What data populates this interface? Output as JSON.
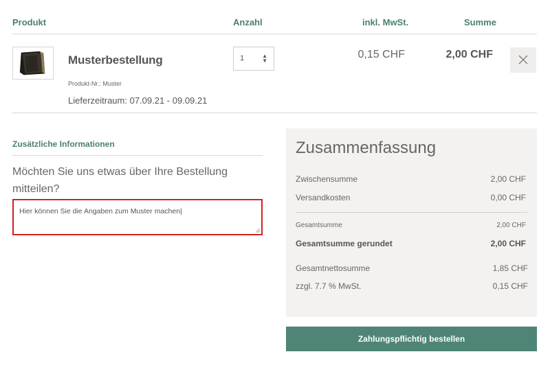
{
  "table_header": {
    "product": "Produkt",
    "quantity": "Anzahl",
    "incl_vat": "inkl. MwSt.",
    "total": "Summe"
  },
  "cart_item": {
    "image_icon": "product-sample-thumbnail",
    "name": "Musterbestellung",
    "product_number": "Produkt-Nr.: Muster",
    "delivery_period": "Lieferzeitraum: 07.09.21 - 09.09.21",
    "quantity": "1",
    "unit_price": "0,15 CHF",
    "total_price": "2,00 CHF",
    "remove_icon": "close-icon"
  },
  "additional_info": {
    "title": "Zusätzliche Informationen",
    "question": "Möchten Sie uns etwas über Ihre Bestellung mitteilen?",
    "notes_value": "Hier können Sie die Angaben zum Muster machen|"
  },
  "summary": {
    "title": "Zusammenfassung",
    "subtotal_label": "Zwischensumme",
    "subtotal_value": "2,00 CHF",
    "shipping_label": "Versandkosten",
    "shipping_value": "0,00 CHF",
    "grand_total_label": "Gesamtsumme",
    "grand_total_value": "2,00 CHF",
    "grand_total_rounded_label": "Gesamtsumme gerundet",
    "grand_total_rounded_value": "2,00 CHF",
    "net_total_label": "Gesamtnettosumme",
    "net_total_value": "1,85 CHF",
    "vat_label": "zzgl. 7.7 % MwSt.",
    "vat_value": "0,15 CHF"
  },
  "checkout": {
    "order_button": "Zahlungspflichtig bestellen"
  },
  "colors": {
    "accent": "#4b7f72",
    "button": "#4e8576",
    "highlight_border": "#d62020",
    "summary_bg": "#f4f2f0"
  }
}
